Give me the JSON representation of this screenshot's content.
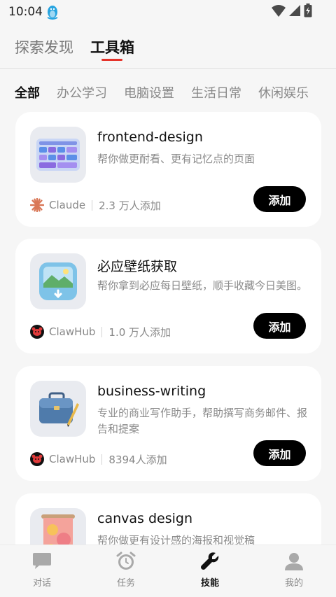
{
  "status_bar": {
    "time": "10:04",
    "app_icon": "penguin-icon",
    "icons": [
      "wifi-icon",
      "cell-signal-icon",
      "battery-charging-icon"
    ]
  },
  "top_tabs": [
    {
      "label": "探索发现",
      "active": false
    },
    {
      "label": "工具箱",
      "active": true
    }
  ],
  "accent_color": "#e5332a",
  "categories": [
    {
      "label": "全部",
      "active": true
    },
    {
      "label": "办公学习",
      "active": false
    },
    {
      "label": "电脑设置",
      "active": false
    },
    {
      "label": "生活日常",
      "active": false
    },
    {
      "label": "休闲娱乐",
      "active": false
    }
  ],
  "skills": [
    {
      "title": "frontend-design",
      "description": "帮你做更耐看、更有记忆点的页面",
      "source": "Claude",
      "source_icon": "claude-starburst-icon",
      "adds": "2.3 万人添加",
      "button": "添加",
      "icon": "dashboard-ui-icon"
    },
    {
      "title": "必应壁纸获取",
      "description": "帮你拿到必应每日壁纸，顺手收藏今日美图。",
      "source": "ClawHub",
      "source_icon": "clawhub-logo-icon",
      "adds": "1.0 万人添加",
      "button": "添加",
      "icon": "landscape-download-icon"
    },
    {
      "title": "business-writing",
      "description": "专业的商业写作助手，帮助撰写商务邮件、报告和提案",
      "source": "ClawHub",
      "source_icon": "clawhub-logo-icon",
      "adds": "8394人添加",
      "button": "添加",
      "icon": "briefcase-pen-icon"
    },
    {
      "title": "canvas design",
      "description": "帮你做更有设计感的海报和视觉稿",
      "icon": "poster-canvas-icon"
    }
  ],
  "bottom_nav": [
    {
      "label": "对话",
      "icon": "chat-bubble-icon",
      "active": false
    },
    {
      "label": "任务",
      "icon": "alarm-clock-icon",
      "active": false
    },
    {
      "label": "技能",
      "icon": "wrench-icon",
      "active": true
    },
    {
      "label": "我的",
      "icon": "person-icon",
      "active": false
    }
  ]
}
